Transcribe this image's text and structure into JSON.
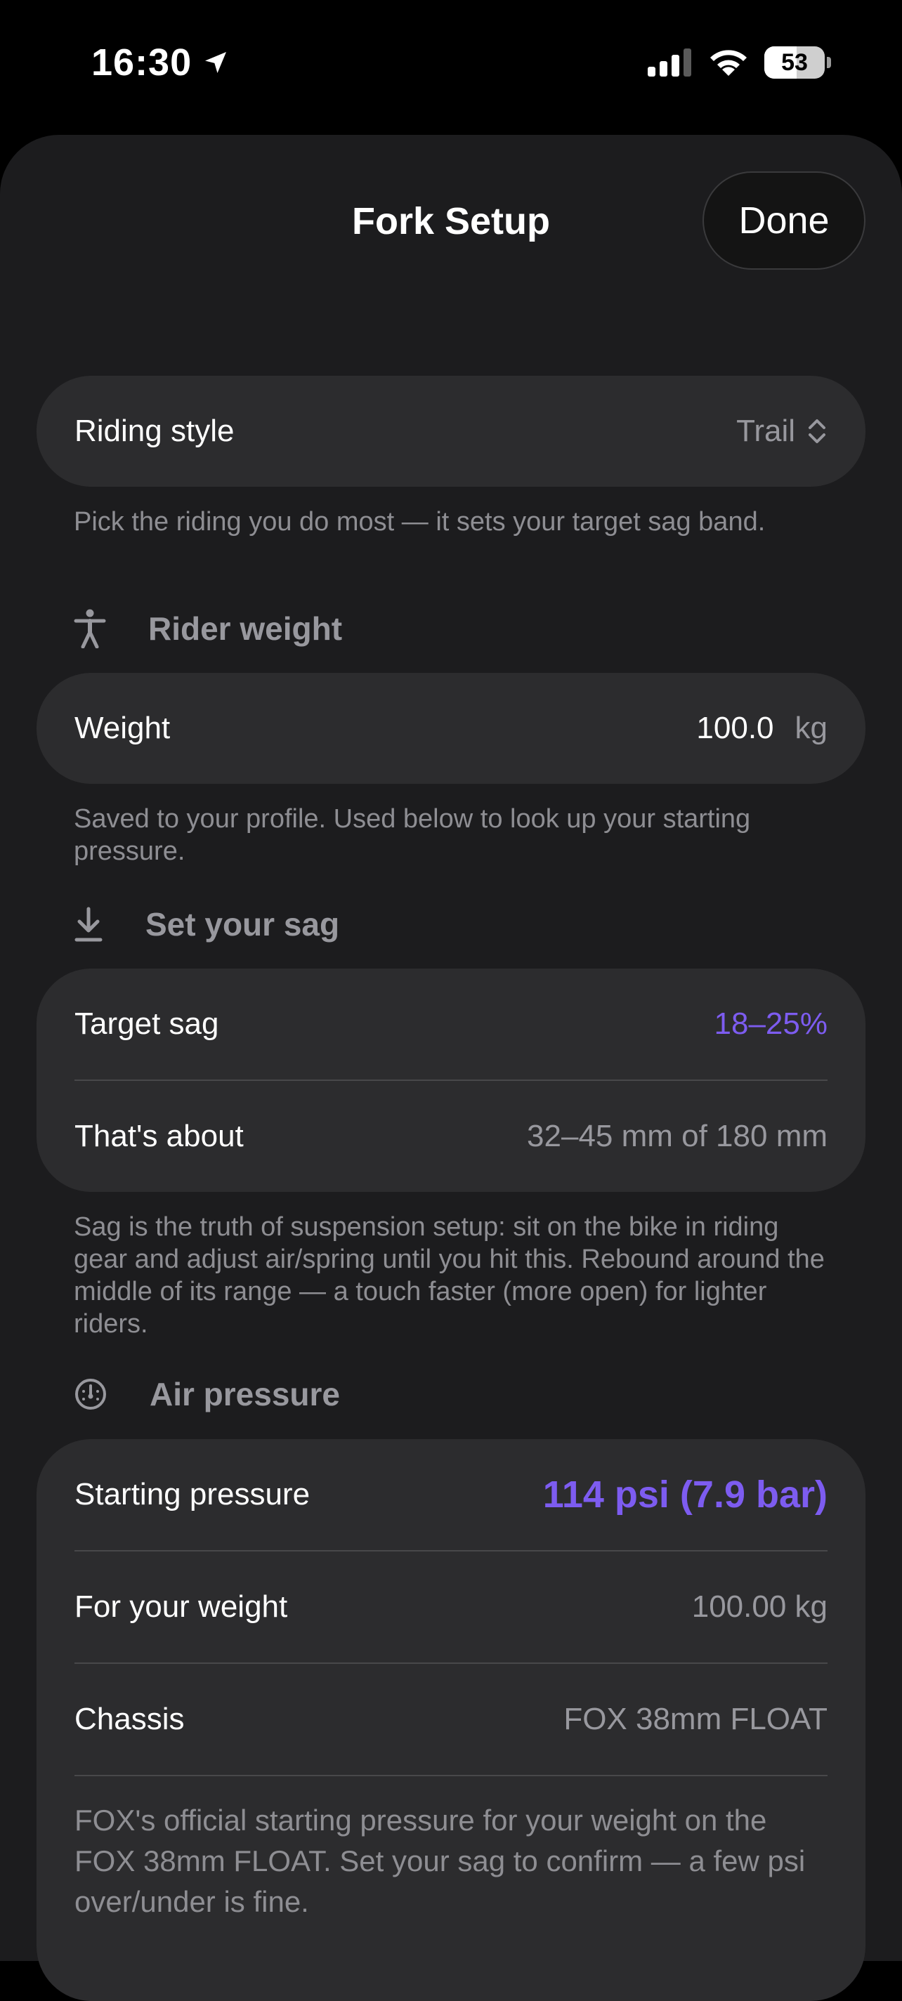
{
  "status_bar": {
    "time": "16:30",
    "battery": "53"
  },
  "sheet": {
    "title": "Fork Setup",
    "done_label": "Done"
  },
  "riding_style": {
    "label": "Riding style",
    "value": "Trail",
    "note": "Pick the riding you do most — it sets your target sag band."
  },
  "rider_weight": {
    "header": "Rider weight",
    "label": "Weight",
    "value": "100.0",
    "unit": "kg",
    "note": "Saved to your profile. Used below to look up your starting pressure."
  },
  "sag": {
    "header": "Set your sag",
    "target_label": "Target sag",
    "target_value": "18–25%",
    "about_label": "That's about",
    "about_value": "32–45 mm of 180 mm",
    "note": "Sag is the truth of suspension setup: sit on the bike in riding gear and adjust air/spring until you hit this. Rebound around the middle of its range — a touch faster (more open) for lighter riders."
  },
  "air_pressure": {
    "header": "Air pressure",
    "starting_label": "Starting pressure",
    "starting_value": "114 psi (7.9 bar)",
    "weight_label": "For your weight",
    "weight_value": "100.00 kg",
    "chassis_label": "Chassis",
    "chassis_value": "FOX 38mm FLOAT",
    "note": "FOX's official starting pressure for your weight on the FOX 38mm FLOAT. Set your sag to confirm — a few psi over/under is fine."
  },
  "colors": {
    "accent": "#7d5cf0",
    "sheet_bg": "#1c1c1e",
    "card_bg": "#2c2c2e"
  }
}
